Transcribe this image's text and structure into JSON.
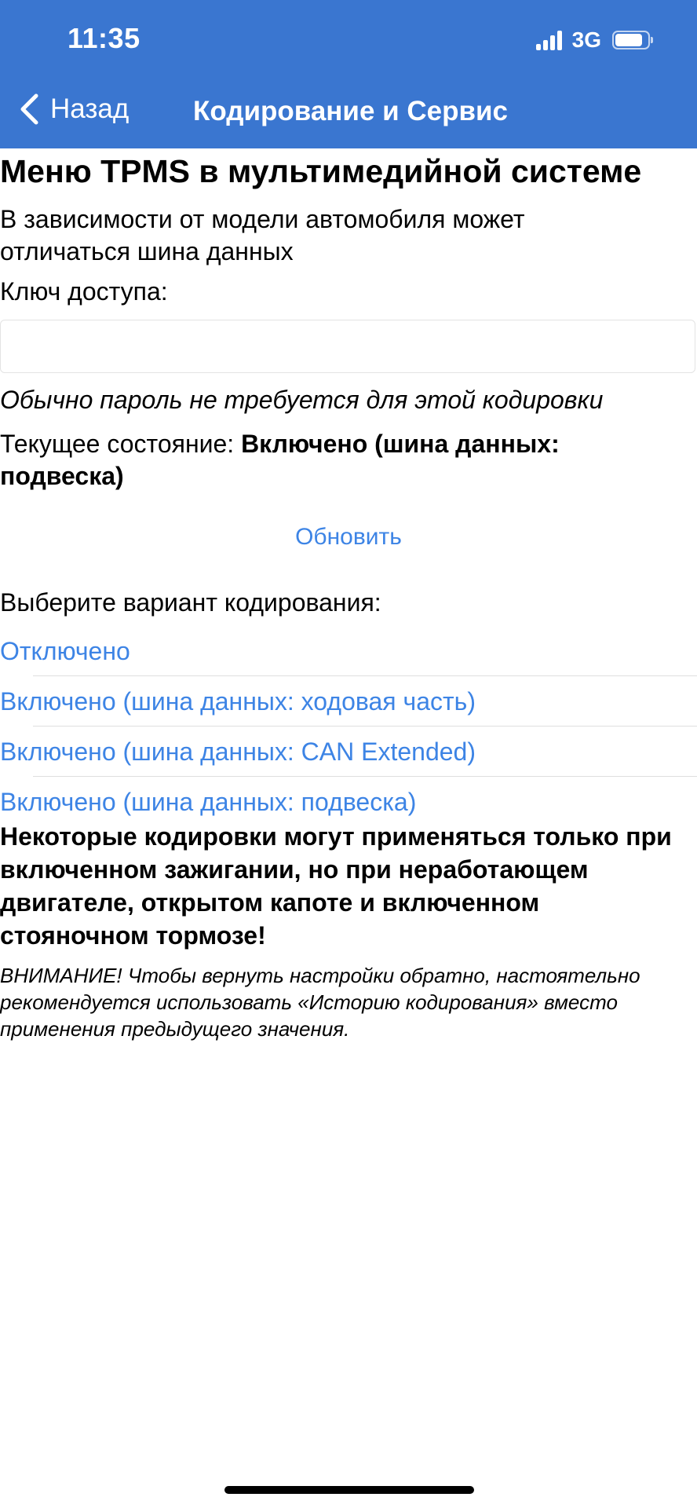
{
  "status_bar": {
    "time": "11:35",
    "network": "3G",
    "signal_icon": "signal-bars-icon",
    "battery_icon": "battery-icon",
    "battery_level": 0.85
  },
  "nav": {
    "back_icon": "chevron-left-icon",
    "back_label": "Назад",
    "title": "Кодирование и Сервис"
  },
  "colors": {
    "header_bg": "#3a76d0",
    "link": "#3d84e5"
  },
  "main": {
    "title": "Меню TPMS в мультимедийной системе",
    "description": "В зависимости от модели автомобиля может отличаться шина данных",
    "key_label": "Ключ доступа:",
    "key_value": "",
    "key_hint": "Обычно пароль не требуется для этой кодировки",
    "state_prefix": "Текущее состояние: ",
    "state_value": "Включено (шина данных: подвеска)",
    "refresh_label": "Обновить",
    "choose_label": "Выберите вариант кодирования:",
    "options": [
      {
        "label": "Отключено"
      },
      {
        "label": "Включено (шина данных: ходовая часть)"
      },
      {
        "label": "Включено (шина данных: CAN Extended)"
      },
      {
        "label": "Включено (шина данных: подвеска)"
      }
    ],
    "notice": "Некоторые кодировки могут применяться только при включенном зажигании, но при неработающем двигателе, открытом капоте и включенном стояночном тормозе!",
    "warning": "ВНИМАНИЕ! Чтобы вернуть настройки обратно, настоятельно рекомендуется использовать «Историю кодирования» вместо применения предыдущего значения."
  }
}
